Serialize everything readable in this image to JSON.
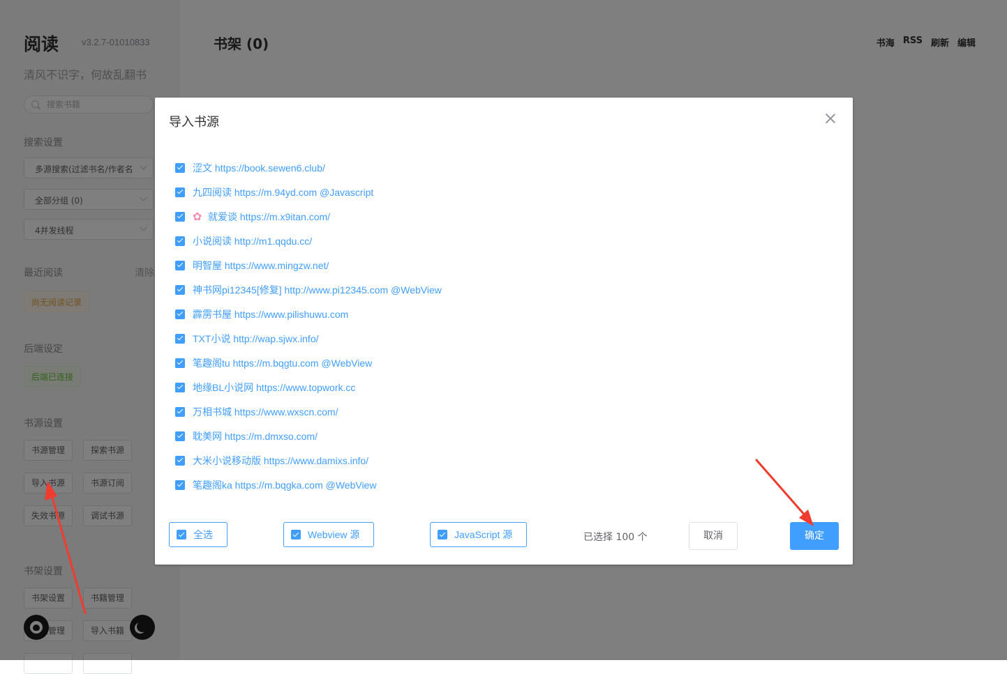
{
  "app": {
    "title": "阅读",
    "version": "v3.2.7-01010833",
    "slogan": "清风不识字，何故乱翻书"
  },
  "sidebar": {
    "search_placeholder": "搜索书籍",
    "search_settings_label": "搜索设置",
    "search_mode": "多源搜索(过滤书名/作者名)",
    "group_select": "全部分组 (0)",
    "thread_select": "4并发线程",
    "recent_label": "最近阅读",
    "clear_label": "清除",
    "no_history": "尚无阅读记录",
    "backend_label": "后端设定",
    "backend_status": "后端已连接",
    "source_settings_label": "书源设置",
    "source_buttons": [
      "书源管理",
      "探索书源",
      "导入书源",
      "书源订阅",
      "失效书源",
      "调试书源"
    ],
    "shelf_settings_label": "书架设置",
    "shelf_buttons": [
      "书架设置",
      "书籍管理",
      "分组管理",
      "导入书籍"
    ]
  },
  "main": {
    "shelf_title": "书架 (0)",
    "top_links": [
      "书海",
      "RSS",
      "刷新",
      "编辑"
    ]
  },
  "dialog": {
    "title": "导入书源",
    "sources": [
      {
        "label": "涩文 https://book.sewen6.club/",
        "icon": null
      },
      {
        "label": "九四阅读 https://m.94yd.com @Javascript",
        "icon": null
      },
      {
        "label": "就爱谈 https://m.x9itan.com/",
        "icon": "flower-icon"
      },
      {
        "label": "小说阅读 http://m1.qqdu.cc/",
        "icon": null
      },
      {
        "label": "明智屋 https://www.mingzw.net/",
        "icon": null
      },
      {
        "label": "神书网pi12345[修复] http://www.pi12345.com @WebView",
        "icon": null
      },
      {
        "label": "霹雳书屋 https://www.pilishuwu.com",
        "icon": null
      },
      {
        "label": "TXT小说 http://wap.sjwx.info/",
        "icon": null
      },
      {
        "label": "笔趣阁tu https://m.bqgtu.com @WebView",
        "icon": null
      },
      {
        "label": "地缘BL小说网 https://www.topwork.cc",
        "icon": null
      },
      {
        "label": "万相书城 https://www.wxscn.com/",
        "icon": null
      },
      {
        "label": "耽美网 https://m.dmxso.com/",
        "icon": null
      },
      {
        "label": "大米小说移动版 https://www.damixs.info/",
        "icon": null
      },
      {
        "label": "笔趣阁ka https://m.bqgka.com @WebView",
        "icon": null
      }
    ],
    "select_all": "全选",
    "webview_filter": "Webview 源",
    "js_filter": "JavaScript 源",
    "selected_count": "已选择 100 个",
    "cancel": "取消",
    "confirm": "确定"
  },
  "colors": {
    "accent": "#409eff",
    "annotation_arrow": "#f03c2e",
    "warning_tag": "#e6a23c",
    "success_tag": "#67c23a"
  }
}
